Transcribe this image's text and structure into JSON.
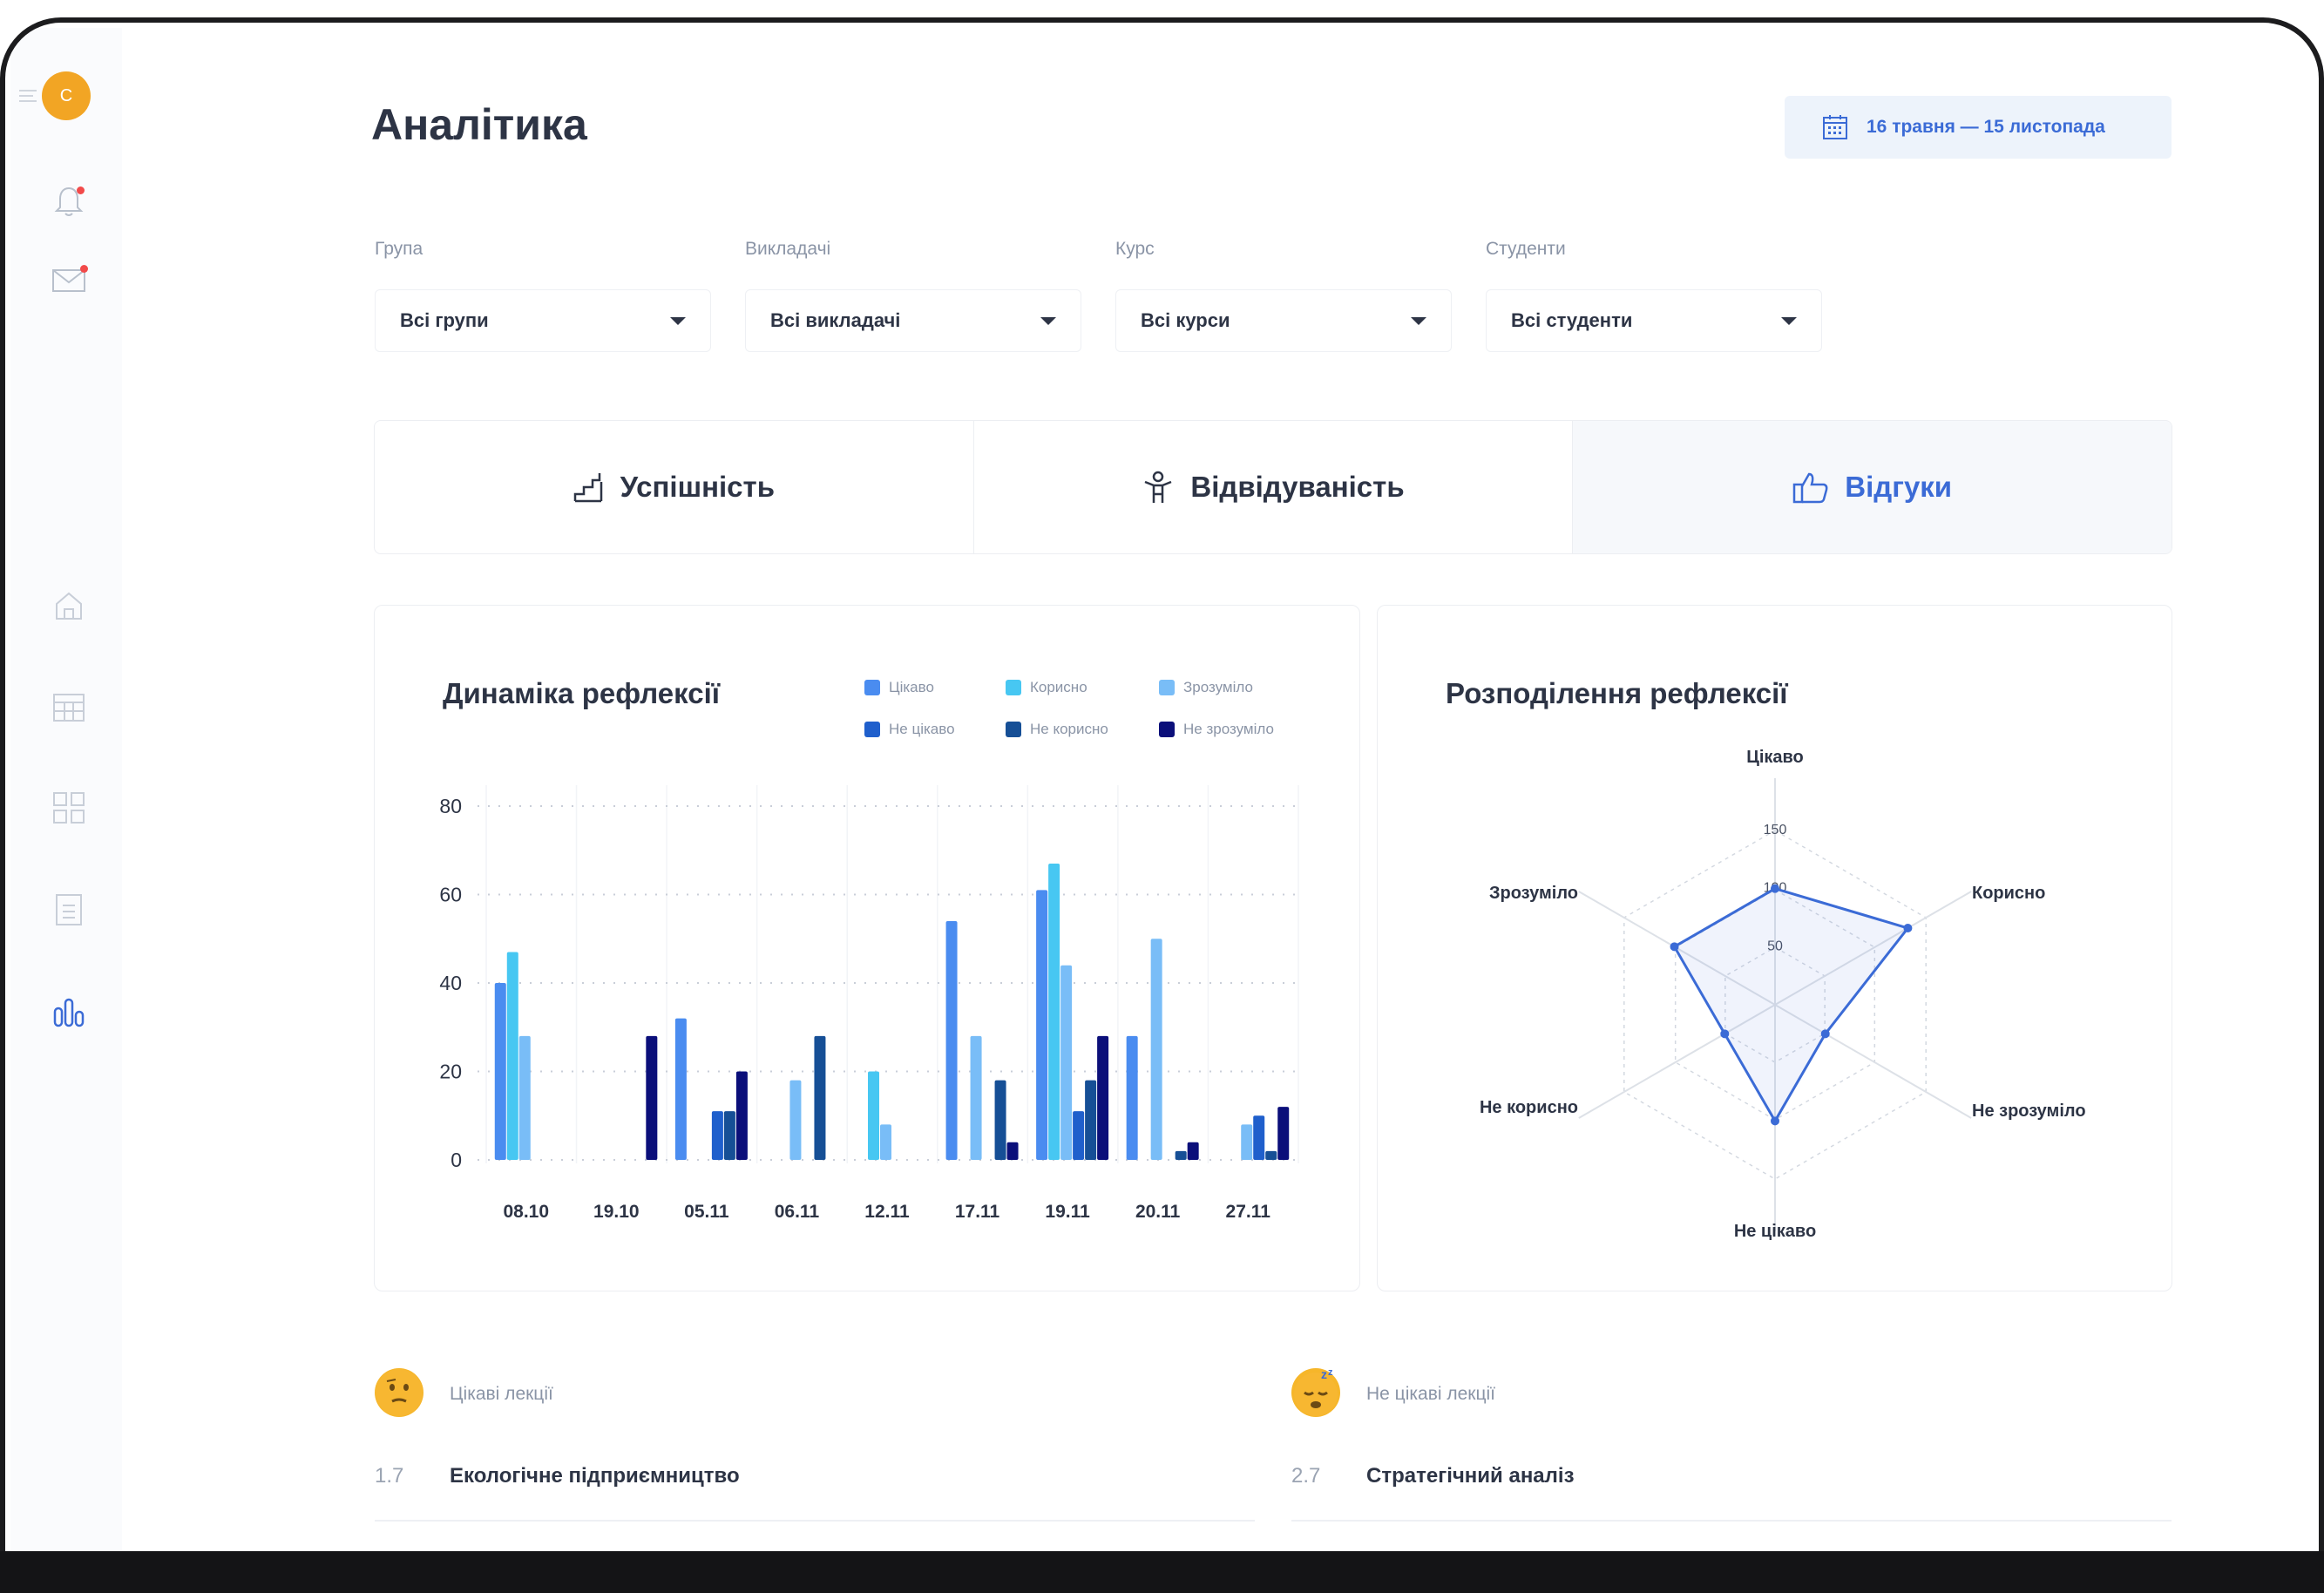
{
  "user": {
    "avatar_letter": "C"
  },
  "page": {
    "title": "Аналітика",
    "date_range": "16 травня — 15 листопада"
  },
  "filters": [
    {
      "label": "Група",
      "value": "Всі групи"
    },
    {
      "label": "Викладачі",
      "value": "Всі викладачі"
    },
    {
      "label": "Курс",
      "value": "Всі курси"
    },
    {
      "label": "Студенти",
      "value": "Всі студенти"
    }
  ],
  "tabs": [
    {
      "label": "Успішність",
      "icon": "stairs-icon"
    },
    {
      "label": "Відвідуваність",
      "icon": "person-icon"
    },
    {
      "label": "Відгуки",
      "icon": "thumbs-up-icon",
      "active": true
    }
  ],
  "sidebar": {
    "icons": [
      "bell-icon",
      "mail-icon",
      "home-icon",
      "calendar-icon",
      "grid-icon",
      "clipboard-icon",
      "analytics-icon"
    ]
  },
  "colors": {
    "accent": "#3b6bd6",
    "text": "#2d3445",
    "muted": "#8a94a6"
  },
  "chart_data": [
    {
      "type": "bar",
      "title": "Динаміка рефлексії",
      "categories": [
        "08.10",
        "19.10",
        "05.11",
        "06.11",
        "12.11",
        "17.11",
        "19.11",
        "20.11",
        "27.11"
      ],
      "ylim": [
        0,
        80
      ],
      "yticks": [
        0,
        20,
        40,
        60,
        80
      ],
      "series": [
        {
          "name": "Цікаво",
          "color": "#4a8cf0",
          "values": [
            40,
            0,
            32,
            0,
            0,
            54,
            61,
            28,
            0
          ]
        },
        {
          "name": "Корисно",
          "color": "#47c7f2",
          "values": [
            47,
            0,
            0,
            0,
            20,
            0,
            67,
            0,
            0
          ]
        },
        {
          "name": "Зрозуміло",
          "color": "#79bdf7",
          "values": [
            28,
            0,
            0,
            18,
            8,
            28,
            44,
            50,
            8
          ]
        },
        {
          "name": "Не цікаво",
          "color": "#1f5fcc",
          "values": [
            0,
            0,
            11,
            0,
            0,
            0,
            11,
            0,
            10
          ]
        },
        {
          "name": "Не корисно",
          "color": "#164f96",
          "values": [
            0,
            0,
            11,
            28,
            0,
            18,
            18,
            2,
            2
          ]
        },
        {
          "name": "Не зрозуміло",
          "color": "#0b0f7a",
          "values": [
            0,
            28,
            20,
            0,
            0,
            4,
            28,
            4,
            12
          ]
        }
      ],
      "grid": true,
      "legend": "top-right"
    },
    {
      "type": "radar",
      "title": "Розподілення рефлексії",
      "axes": [
        "Цікаво",
        "Корисно",
        "Не зрозуміло",
        "Не цікаво",
        "Не корисно",
        "Зрозуміло"
      ],
      "rticks": [
        50,
        100,
        150
      ],
      "rmax": 150,
      "values": [
        100,
        132,
        50,
        100,
        50,
        100
      ]
    }
  ],
  "lectures": {
    "interesting": {
      "heading": "Цікаві лекції",
      "items": [
        {
          "num": "1.7",
          "name": "Екологічне підприємництво"
        }
      ]
    },
    "boring": {
      "heading": "Не цікаві лекції",
      "items": [
        {
          "num": "2.7",
          "name": "Стратегічний аналіз"
        }
      ]
    }
  }
}
